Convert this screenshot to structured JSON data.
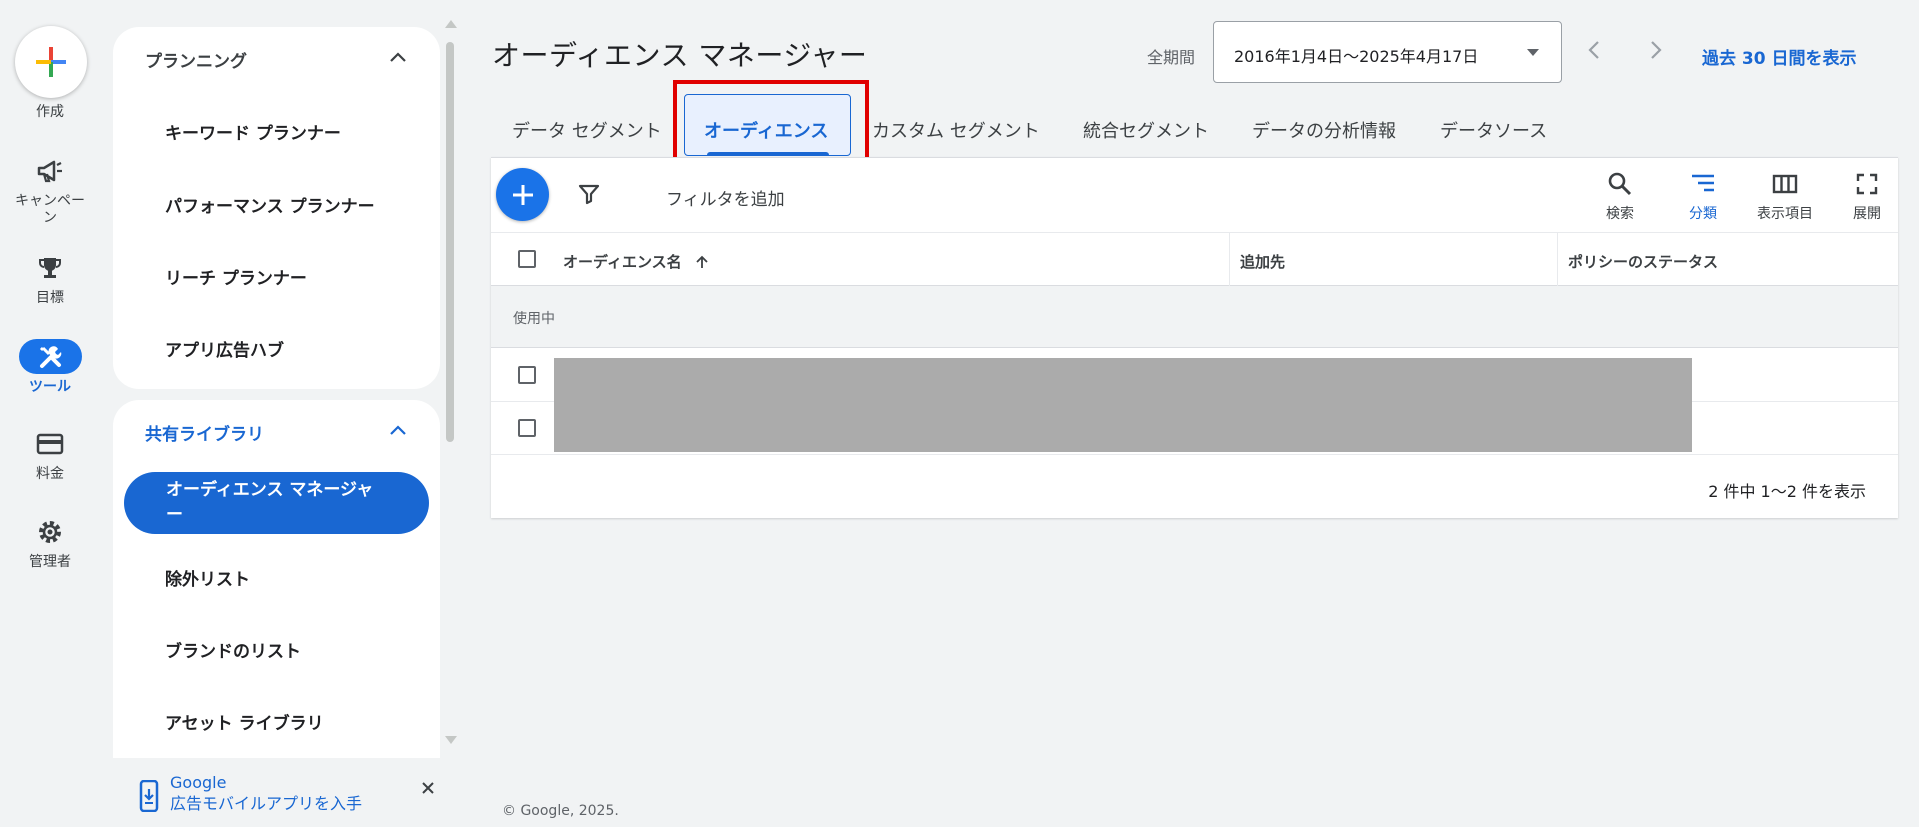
{
  "rail": {
    "create_label": "作成",
    "campaign_label_1": "キャンペー",
    "campaign_label_2": "ン",
    "goals_label": "目標",
    "tools_label": "ツール",
    "billing_label": "料金",
    "admin_label": "管理者"
  },
  "nav": {
    "planning": {
      "header": "プランニング",
      "items": [
        "キーワード プランナー",
        "パフォーマンス プランナー",
        "リーチ プランナー",
        "アプリ広告ハブ"
      ]
    },
    "shared_library": {
      "header": "共有ライブラリ",
      "active_line1": "オーディエンス マネージャ",
      "active_line2": "ー",
      "items": [
        "除外リスト",
        "ブランドのリスト",
        "アセット ライブラリ"
      ]
    },
    "promo_line1": "Google",
    "promo_line2": "広告モバイルアプリを入手"
  },
  "header": {
    "title": "オーディエンス マネージャー",
    "period_label": "全期間",
    "date_range": "2016年1月4日～2025年4月17日",
    "show_30": "過去 30 日間を表示"
  },
  "tabs": [
    "データ セグメント",
    "オーディエンス",
    "カスタム セグメント",
    "統合セグメント",
    "データの分析情報",
    "データソース"
  ],
  "toolbar": {
    "filter_add": "フィルタを追加",
    "search_label": "検索",
    "segment_label": "分類",
    "columns_label": "表示項目",
    "expand_label": "展開"
  },
  "table": {
    "headers": [
      "オーディエンス名",
      "追加先",
      "ポリシーのステータス"
    ],
    "group_label": "使用中",
    "pagination": "2 件中 1～2 件を表示"
  },
  "footer": "© Google, 2025.",
  "colors": {
    "accent": "#1a73e8",
    "accent_dark": "#1967d2",
    "highlight": "#e00000"
  }
}
